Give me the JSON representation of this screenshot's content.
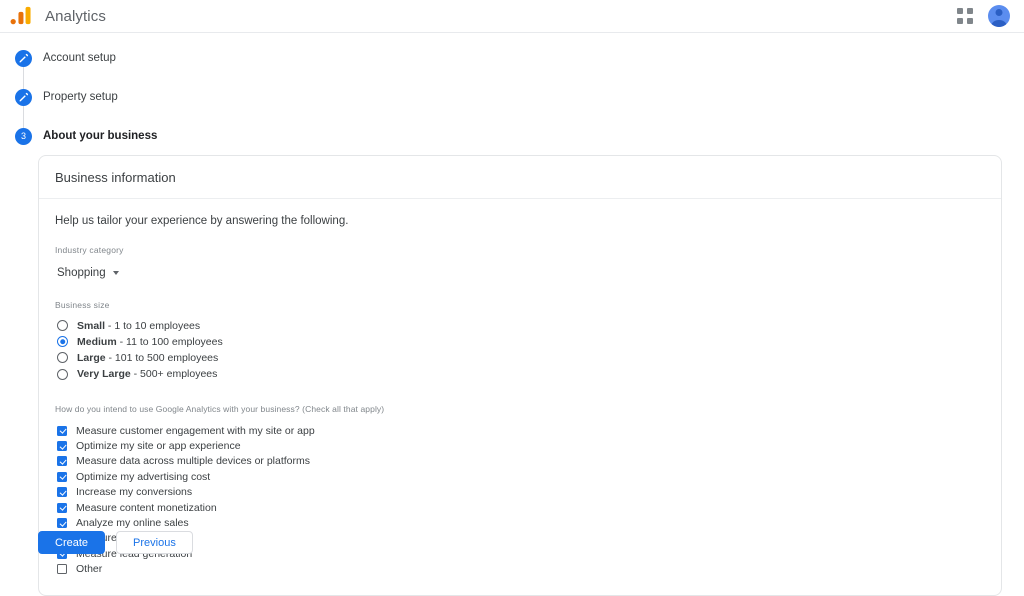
{
  "header": {
    "logo_icon": "analytics-bars-icon",
    "title": "Analytics",
    "apps_icon": "apps-grid-icon",
    "avatar_icon": "account-avatar-icon"
  },
  "stepper": {
    "steps": [
      {
        "marker": "",
        "icon": "pencil-icon",
        "label": "Account setup",
        "state": "complete"
      },
      {
        "marker": "",
        "icon": "pencil-icon",
        "label": "Property setup",
        "state": "complete"
      },
      {
        "marker": "3",
        "icon": "step-number",
        "label": "About your business",
        "state": "active"
      }
    ]
  },
  "card": {
    "header_title": "Business information",
    "intro": "Help us tailor your experience by answering the following.",
    "industry": {
      "label": "Industry category",
      "value": "Shopping",
      "caret_icon": "chevron-down-icon"
    },
    "business_size": {
      "label": "Business size",
      "options": [
        {
          "name": "Small",
          "detail": " - 1 to 10 employees",
          "checked": false
        },
        {
          "name": "Medium",
          "detail": " - 11 to 100 employees",
          "checked": true
        },
        {
          "name": "Large",
          "detail": " - 101 to 500 employees",
          "checked": false
        },
        {
          "name": "Very Large",
          "detail": " - 500+ employees",
          "checked": false
        }
      ]
    },
    "intent": {
      "label": "How do you intend to use Google Analytics with your business? (Check all that apply)",
      "options": [
        {
          "label": "Measure customer engagement with my site or app",
          "checked": true
        },
        {
          "label": "Optimize my site or app experience",
          "checked": true
        },
        {
          "label": "Measure data across multiple devices or platforms",
          "checked": true
        },
        {
          "label": "Optimize my advertising cost",
          "checked": true
        },
        {
          "label": "Increase my conversions",
          "checked": true
        },
        {
          "label": "Measure content monetization",
          "checked": true
        },
        {
          "label": "Analyze my online sales",
          "checked": true
        },
        {
          "label": "Measure app installs",
          "checked": true
        },
        {
          "label": "Measure lead generation",
          "checked": true
        },
        {
          "label": "Other",
          "checked": false
        }
      ]
    }
  },
  "actions": {
    "create_label": "Create",
    "previous_label": "Previous"
  },
  "colors": {
    "accent_blue": "#1a73e8",
    "logo_orange": "#f9ab00",
    "logo_orange_dark": "#e8710a",
    "text_primary": "#3c4043",
    "text_secondary": "#80868b",
    "border": "#dadce0"
  }
}
